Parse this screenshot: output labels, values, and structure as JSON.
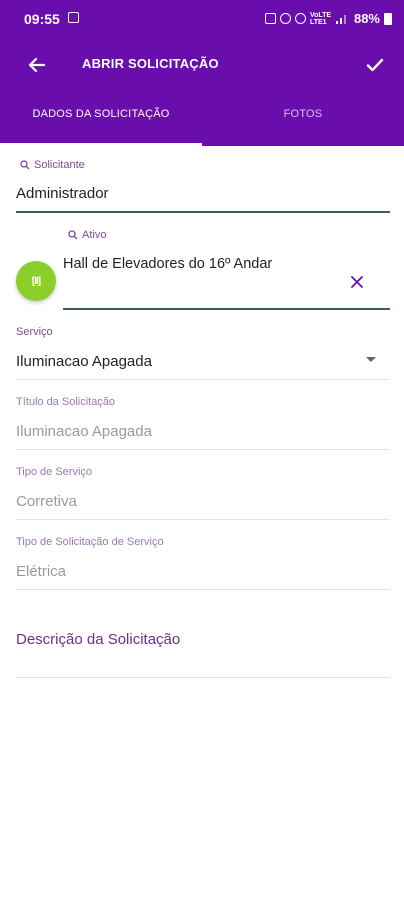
{
  "status_bar": {
    "time": "09:55",
    "battery_percent": "88%",
    "network_text": "VoLTE LTE1",
    "icons": [
      "photo-icon",
      "battery-saver-icon",
      "alarm-icon",
      "mute-icon",
      "signal-icon",
      "battery-icon"
    ]
  },
  "toolbar": {
    "back_icon": "arrow-left-icon",
    "title": "ABRIR SOLICITAÇÃO",
    "confirm_icon": "check-icon"
  },
  "tabs": [
    {
      "label": "DADOS DA SOLICITAÇÃO",
      "active": true
    },
    {
      "label": "FOTOS",
      "active": false
    }
  ],
  "form": {
    "solicitante": {
      "label": "Solicitante",
      "value": "Administrador"
    },
    "ativo": {
      "label": "Ativo",
      "value": "Hall de Elevadores do 16º Andar",
      "scan_glyph": "[II]"
    },
    "servico": {
      "label": "Serviço",
      "value": "Iluminacao Apagada"
    },
    "titulo": {
      "label": "Título da Solicitação",
      "value": "Iluminacao Apagada"
    },
    "tipo_servico": {
      "label": "Tipo de Serviço",
      "value": "Corretiva"
    },
    "tipo_solicitacao": {
      "label": "Tipo de Solicitação de Serviço",
      "value": "Elétrica"
    },
    "descricao": {
      "placeholder": "Descrição da Solicitação"
    }
  },
  "colors": {
    "primary": "#6a0dad",
    "accent_green": "#8ccf2a",
    "label_purple": "#7a4a9a"
  }
}
